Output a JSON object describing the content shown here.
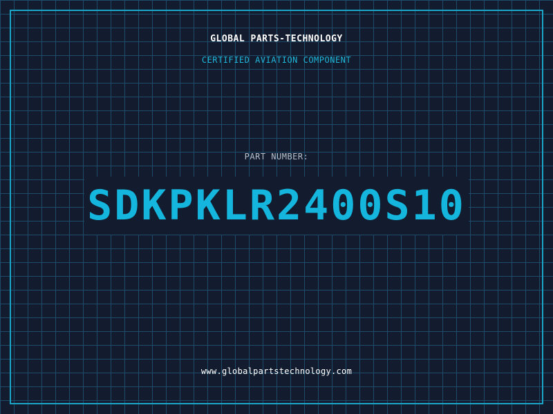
{
  "header": {
    "company": "GLOBAL PARTS-TECHNOLOGY",
    "tagline": "CERTIFIED AVIATION COMPONENT"
  },
  "part": {
    "label": "PART NUMBER:",
    "number": "SDKPKLR2400S10"
  },
  "footer": {
    "url": "www.globalpartstechnology.com"
  },
  "colors": {
    "background": "#131c2e",
    "grid": "#1e4b6a",
    "accent": "#1aa6c9"
  }
}
